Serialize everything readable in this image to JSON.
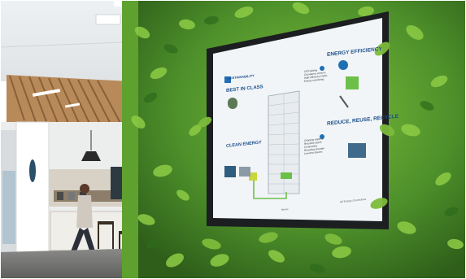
{
  "screen": {
    "header_left": "SUSTAINABILITY",
    "sections": {
      "best_in_class": "BEST IN CLASS",
      "energy_efficiency": "ENERGY EFFICIENCY",
      "clean_energy": "CLEAN ENERGY",
      "reduce_reuse_recycle": "REDUCE, REUSE, RECYCLE"
    },
    "energy_bullets": [
      "LED lighting",
      "Occupancy sensors",
      "High-efficiency HVAC",
      "Energy monitoring"
    ],
    "recycle_bullets": [
      "Charging stations",
      "Recycled carpet",
      "Composting",
      "Recycling program",
      "Low-flow fixtures"
    ],
    "footer_brand": "GE Energy Connections",
    "footer_small": "Nexus"
  },
  "colors": {
    "wall_green": "#4d8f2a",
    "screen_white": "#f2f5f8",
    "title_blue": "#1a4f8a",
    "accent_green": "#6cc04a"
  },
  "icons": [
    "leaf-icon",
    "lightbulb-icon",
    "recycle-icon",
    "ge-logo-icon"
  ]
}
